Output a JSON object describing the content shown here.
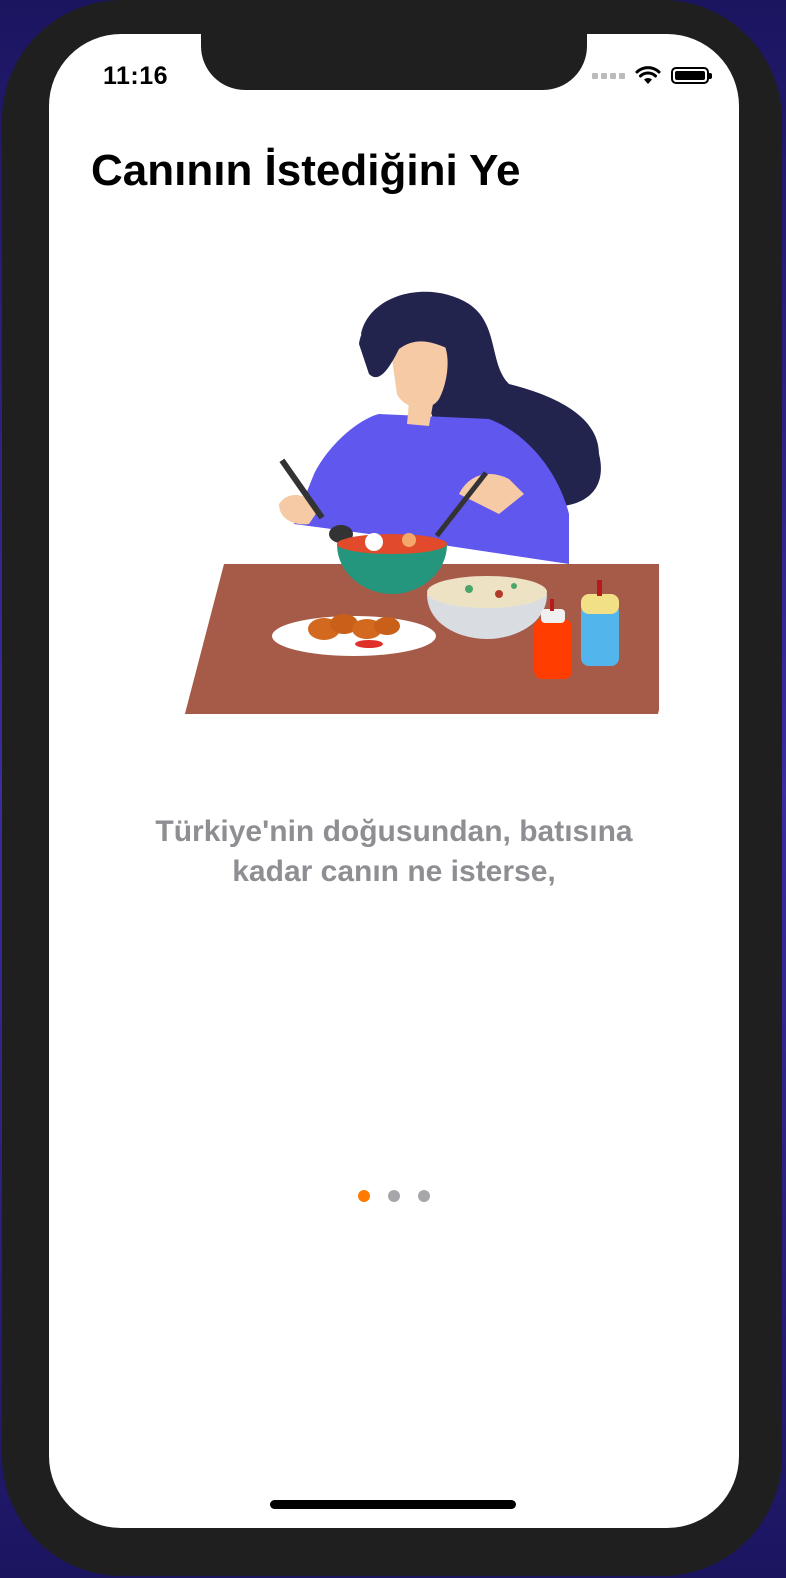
{
  "status_bar": {
    "time": "11:16"
  },
  "onboarding": {
    "title": "Canının İstediğini Ye",
    "description_line1": "Türkiye'nin doğusundan, batısına",
    "description_line2": "kadar canın ne isterse,",
    "illustration": "woman-eating-at-table-illustration",
    "pages": 3,
    "current_page": 1
  },
  "colors": {
    "accent": "#ff7a00",
    "dot_inactive": "#a7a7ab",
    "description_text": "#8e8e93",
    "title_text": "#000000"
  }
}
